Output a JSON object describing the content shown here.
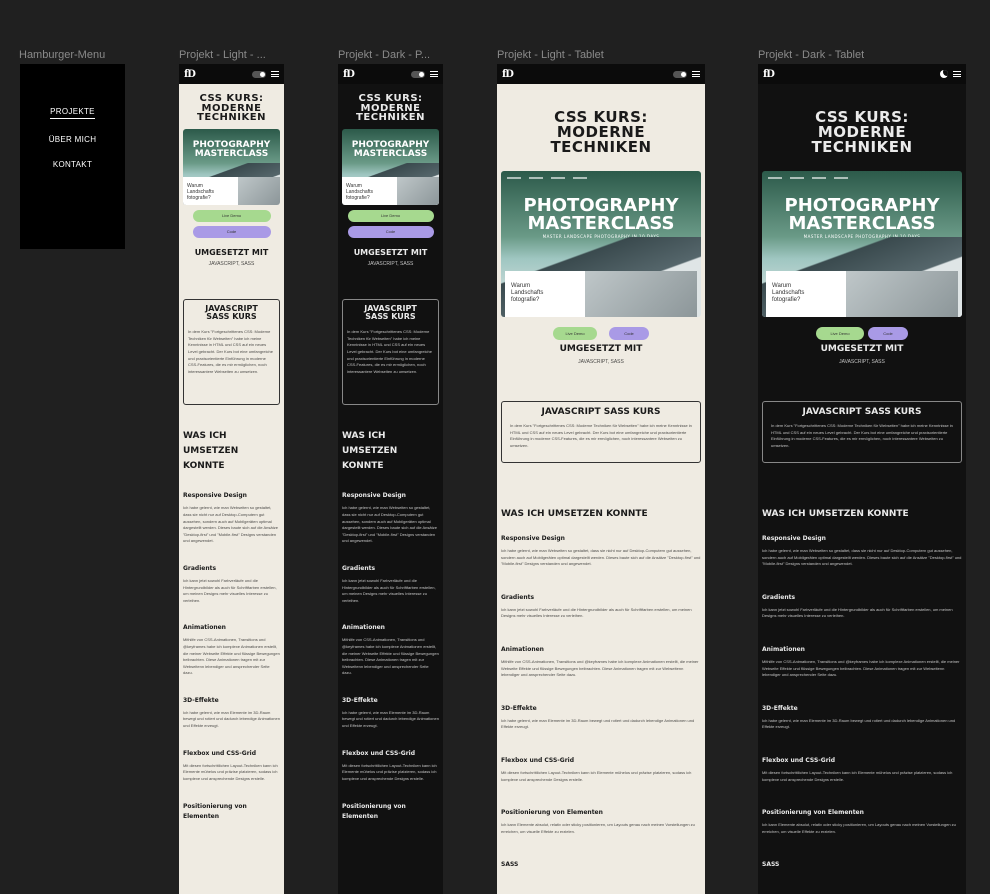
{
  "labels": {
    "menu": "Hamburger-Menu",
    "light_mobile": "Projekt - Light - ...",
    "dark_mobile": "Projekt - Dark - P...",
    "light_tablet": "Projekt - Light - Tablet",
    "dark_tablet": "Projekt - Dark - Tablet"
  },
  "menu": {
    "items": [
      "PROJEKTE",
      "ÜBER MICH",
      "KONTAKT"
    ]
  },
  "header": {
    "logo": "fD"
  },
  "project": {
    "title_line1": "CSS KURS:",
    "title_line2": "MODERNE",
    "title_line3": "TECHNIKEN",
    "hero_line1": "PHOTOGRAPHY",
    "hero_line2": "MASTERCLASS",
    "hero_tag": "MASTER LANDSCAPE PHOTOGRAPHY IN 10 DAYS",
    "card_text": "Warum Landschafts fotografie?",
    "btn_live": "Live Demo",
    "btn_code": "Code",
    "built_with_title": "UMGESETZT MIT",
    "built_with_sub": "JAVASCRIPT, SASS",
    "course_title": "JAVASCRIPT SASS KURS",
    "course_text": "In dem Kurs \"Fortgeschrittenes CSS: Moderne Techniken für Webseiten\" habe ich meine Kenntnisse in HTML und CSS auf ein neues Level gebracht. Der Kurs bot eine umfangreiche und praxisorientierte Einführung in moderne CSS-Features, die es mir ermöglichen, noch interessantere Webseiten zu umsetzen.",
    "learned_title": "WAS ICH UMSETZEN KONNTE",
    "sections": [
      {
        "title": "Responsive Design",
        "text": "Ich habe gelernt, wie man Webseiten so gestaltet, dass sie nicht nur auf Desktop-Computern gut aussehen, sondern auch auf Mobilgeräten optimal dargestellt werden. Dieses baute sich auf die Ansätze \"Desktop-first\" und \"Mobile-first\" Designs verstanden und angewendet."
      },
      {
        "title": "Gradients",
        "text": "Ich kann jetzt sowohl Farbverläufe und die Hintergrundbilder als auch für Schriftfarben erstellen, um meinen Designs mehr visuelles Interesse zu verleihen."
      },
      {
        "title": "Animationen",
        "text": "Mithilfe von CSS-Animationen, Transitions und @keyframes habe ich komplexe Animationen erstellt, die meiner Webseite Effekte und flüssige Bewegungen beibrachten. Diese Animationen tragen mit zur Webseitenn lebendiger und ansprechender Seite dazu."
      },
      {
        "title": "3D-Effekte",
        "text": "Ich habe gelernt, wie man Elemente im 3D-Raum bewegt und rotiert und dadurch lebendige Animationen und Effekte erzeugt."
      },
      {
        "title": "Flexbox und CSS-Grid",
        "text": "Mit diesen fortschrittlichen Layout-Techniken kann ich Elemente mühelos und präzise platzieren, sodass ich komplexe und ansprechende Designs erstelle."
      },
      {
        "title": "Positionierung von Elementen",
        "text": "Ich kann Elemente absolut, relativ oder sticky positionieren, um Layouts genau nach meinen Vorstellungen zu erreichen, um visuelle Effekte zu erzielen."
      },
      {
        "title": "SASS",
        "text": ""
      }
    ]
  }
}
